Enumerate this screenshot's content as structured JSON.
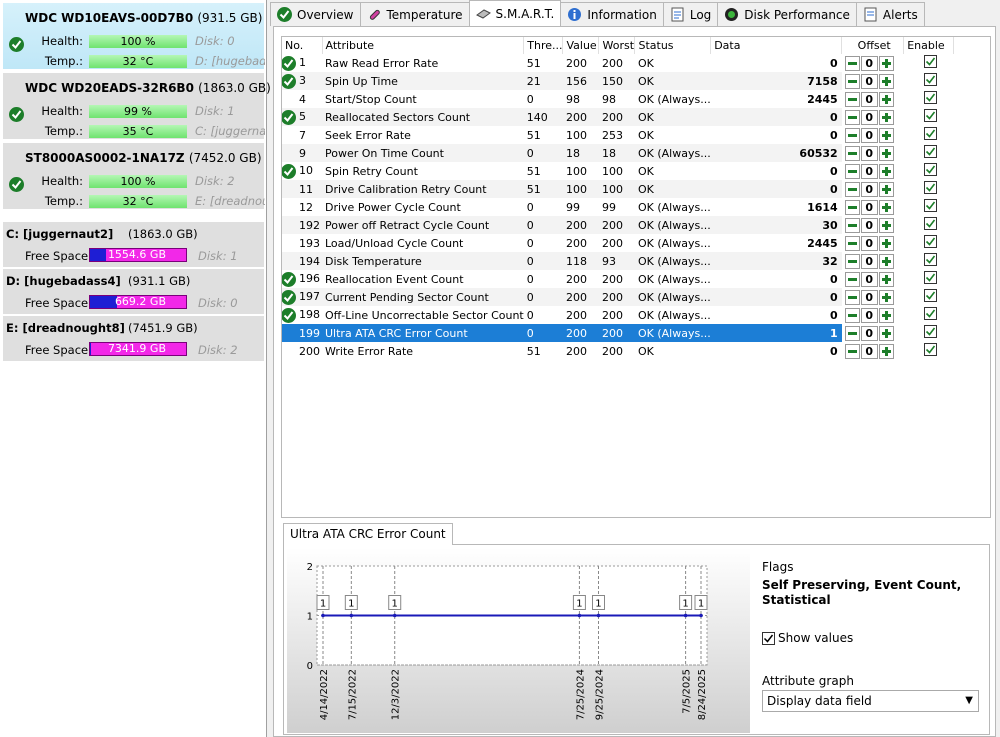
{
  "disks": [
    {
      "name": "WDC WD10EAVS-00D7B0",
      "size": "(931.5 GB)",
      "health_label": "Health:",
      "health": "100 %",
      "temp_label": "Temp.:",
      "temp": "32 °C",
      "disk": "Disk: 0",
      "vol": "D: [hugebada",
      "selected": true
    },
    {
      "name": "WDC WD20EADS-32R6B0",
      "size": "(1863.0 GB)",
      "health_label": "Health:",
      "health": "99 %",
      "temp_label": "Temp.:",
      "temp": "35 °C",
      "disk": "Disk: 1",
      "vol": "C: [juggernau",
      "selected": false
    },
    {
      "name": "ST8000AS0002-1NA17Z",
      "size": "(7452.0 GB)",
      "health_label": "Health:",
      "health": "100 %",
      "temp_label": "Temp.:",
      "temp": "32 °C",
      "disk": "Disk: 2",
      "vol": "E: [dreadnoug",
      "selected": false
    }
  ],
  "volumes": [
    {
      "name": "C: [juggernaut2]",
      "size": "(1863.0 GB)",
      "free_label": "Free Space",
      "free": "1554.6 GB",
      "used_fraction": 0.17,
      "disk": "Disk: 1"
    },
    {
      "name": "D: [hugebadass4]",
      "size": "(931.1 GB)",
      "free_label": "Free Space",
      "free": "669.2 GB",
      "used_fraction": 0.28,
      "disk": "Disk: 0"
    },
    {
      "name": "E: [dreadnought8]",
      "size": "(7451.9 GB)",
      "free_label": "Free Space",
      "free": "7341.9 GB",
      "used_fraction": 0.015,
      "disk": "Disk: 2"
    }
  ],
  "tabs": [
    {
      "label": "Overview",
      "icon": "overview-check-icon"
    },
    {
      "label": "Temperature",
      "icon": "thermometer-icon"
    },
    {
      "label": "S.M.A.R.T.",
      "icon": "smart-drive-icon",
      "active": true
    },
    {
      "label": "Information",
      "icon": "info-icon"
    },
    {
      "label": "Log",
      "icon": "log-icon"
    },
    {
      "label": "Disk Performance",
      "icon": "performance-icon"
    },
    {
      "label": "Alerts",
      "icon": "alerts-icon"
    }
  ],
  "columns": [
    "No.",
    "Attribute",
    "Thre...",
    "Value",
    "Worst",
    "Status",
    "Data",
    "Offset",
    "Enable"
  ],
  "rows": [
    {
      "no": "1",
      "attr": "Raw Read Error Rate",
      "thr": "51",
      "val": "200",
      "worst": "200",
      "status": "OK",
      "data": "0",
      "ok": true
    },
    {
      "no": "3",
      "attr": "Spin Up Time",
      "thr": "21",
      "val": "156",
      "worst": "150",
      "status": "OK",
      "data": "7158",
      "ok": true
    },
    {
      "no": "4",
      "attr": "Start/Stop Count",
      "thr": "0",
      "val": "98",
      "worst": "98",
      "status": "OK (Always...",
      "data": "2445",
      "ok": false
    },
    {
      "no": "5",
      "attr": "Reallocated Sectors Count",
      "thr": "140",
      "val": "200",
      "worst": "200",
      "status": "OK",
      "data": "0",
      "ok": true
    },
    {
      "no": "7",
      "attr": "Seek Error Rate",
      "thr": "51",
      "val": "100",
      "worst": "253",
      "status": "OK",
      "data": "0",
      "ok": false
    },
    {
      "no": "9",
      "attr": "Power On Time Count",
      "thr": "0",
      "val": "18",
      "worst": "18",
      "status": "OK (Always...",
      "data": "60532",
      "ok": false
    },
    {
      "no": "10",
      "attr": "Spin Retry Count",
      "thr": "51",
      "val": "100",
      "worst": "100",
      "status": "OK",
      "data": "0",
      "ok": true
    },
    {
      "no": "11",
      "attr": "Drive Calibration Retry Count",
      "thr": "51",
      "val": "100",
      "worst": "100",
      "status": "OK",
      "data": "0",
      "ok": false
    },
    {
      "no": "12",
      "attr": "Drive Power Cycle Count",
      "thr": "0",
      "val": "99",
      "worst": "99",
      "status": "OK (Always...",
      "data": "1614",
      "ok": false
    },
    {
      "no": "192",
      "attr": "Power off Retract Cycle Count",
      "thr": "0",
      "val": "200",
      "worst": "200",
      "status": "OK (Always...",
      "data": "30",
      "ok": false
    },
    {
      "no": "193",
      "attr": "Load/Unload Cycle Count",
      "thr": "0",
      "val": "200",
      "worst": "200",
      "status": "OK (Always...",
      "data": "2445",
      "ok": false
    },
    {
      "no": "194",
      "attr": "Disk Temperature",
      "thr": "0",
      "val": "118",
      "worst": "93",
      "status": "OK (Always...",
      "data": "32",
      "ok": false
    },
    {
      "no": "196",
      "attr": "Reallocation Event Count",
      "thr": "0",
      "val": "200",
      "worst": "200",
      "status": "OK (Always...",
      "data": "0",
      "ok": true
    },
    {
      "no": "197",
      "attr": "Current Pending Sector Count",
      "thr": "0",
      "val": "200",
      "worst": "200",
      "status": "OK (Always...",
      "data": "0",
      "ok": true
    },
    {
      "no": "198",
      "attr": "Off-Line Uncorrectable Sector Count",
      "thr": "0",
      "val": "200",
      "worst": "200",
      "status": "OK (Always...",
      "data": "0",
      "ok": true
    },
    {
      "no": "199",
      "attr": "Ultra ATA CRC Error Count",
      "thr": "0",
      "val": "200",
      "worst": "200",
      "status": "OK (Always...",
      "data": "1",
      "ok": false,
      "selected": true
    },
    {
      "no": "200",
      "attr": "Write Error Rate",
      "thr": "51",
      "val": "200",
      "worst": "200",
      "status": "OK",
      "data": "0",
      "ok": false
    }
  ],
  "offset_value": "0",
  "detail": {
    "tab": "Ultra ATA CRC Error Count",
    "flags_label": "Flags",
    "flags_value": "Self Preserving, Event Count, Statistical",
    "show_values": "Show values",
    "attr_graph_label": "Attribute graph",
    "attr_graph_value": "Display data field"
  },
  "chart_data": {
    "type": "line",
    "x": [
      "4/14/2022",
      "7/15/2022",
      "12/3/2022",
      "7/25/2024",
      "9/25/2024",
      "7/5/2025",
      "8/24/2025"
    ],
    "series": [
      {
        "values": [
          1,
          1,
          1,
          1,
          1,
          1,
          1
        ]
      }
    ],
    "data_labels": [
      "1",
      "1",
      "1",
      "1",
      "1",
      "1",
      "1"
    ],
    "ylim": [
      0,
      2
    ],
    "yticks": [
      "0",
      "1",
      "2"
    ],
    "colors": {
      "line": "#1a1ab8"
    }
  },
  "colors": {
    "ok_green": "#1d7e2a",
    "selection": "#1c7ed6",
    "free_space": "#f228e8",
    "used_space": "#1e1ed4",
    "health_green": "#6fe36f"
  }
}
